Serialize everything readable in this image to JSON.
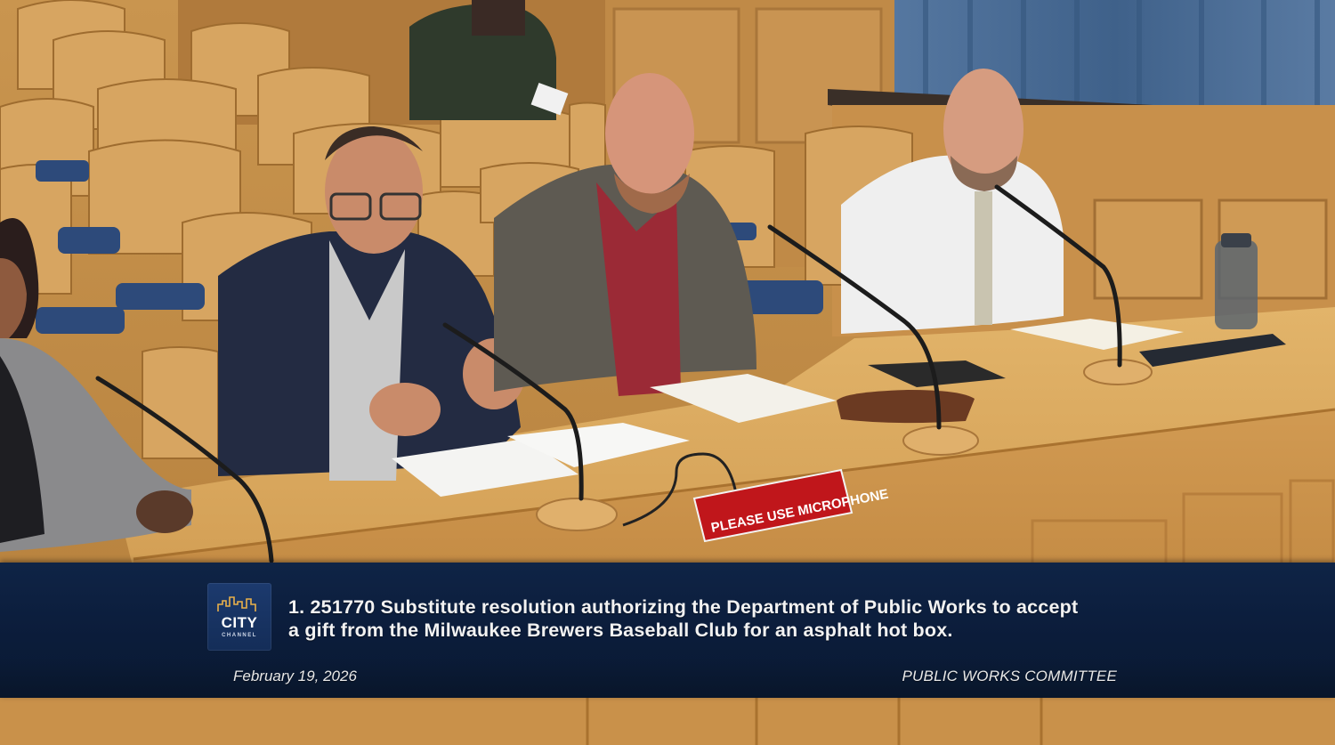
{
  "overlay": {
    "logo_city": "CITY",
    "logo_channel": "CHANNEL",
    "item_line1": "1. 251770 Substitute resolution authorizing the Department of Public Works to accept",
    "item_line2": "a gift from the Milwaukee Brewers Baseball Club for an asphalt hot box.",
    "date": "February 19, 2026",
    "committee": "PUBLIC WORKS COMMITTEE"
  },
  "scene": {
    "table_sign": "PLEASE USE MICROPHONE"
  },
  "colors": {
    "banner": "#0f2446",
    "table_wood": "#d9a85e",
    "sign_red": "#c0161b",
    "curtain": "#4a6a8e"
  }
}
